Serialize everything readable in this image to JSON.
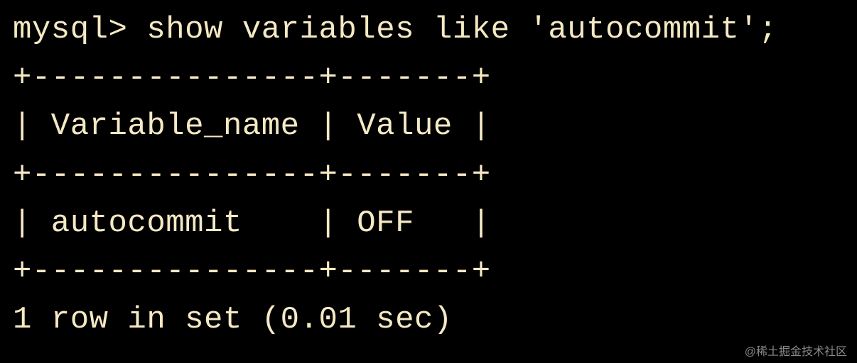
{
  "terminal": {
    "prompt": "mysql> ",
    "command": "show variables like 'autocommit';",
    "border_top": "+---------------+-------+",
    "header_row": "| Variable_name | Value |",
    "border_mid": "+---------------+-------+",
    "data_row": "| autocommit    | OFF   |",
    "border_bottom": "+---------------+-------+",
    "status": "1 row in set (0.01 sec)"
  },
  "watermark": "@稀土掘金技术社区",
  "chart_data": {
    "type": "table",
    "title": "MySQL SHOW VARIABLES result",
    "columns": [
      "Variable_name",
      "Value"
    ],
    "rows": [
      [
        "autocommit",
        "OFF"
      ]
    ],
    "row_count": 1,
    "elapsed_seconds": 0.01
  }
}
